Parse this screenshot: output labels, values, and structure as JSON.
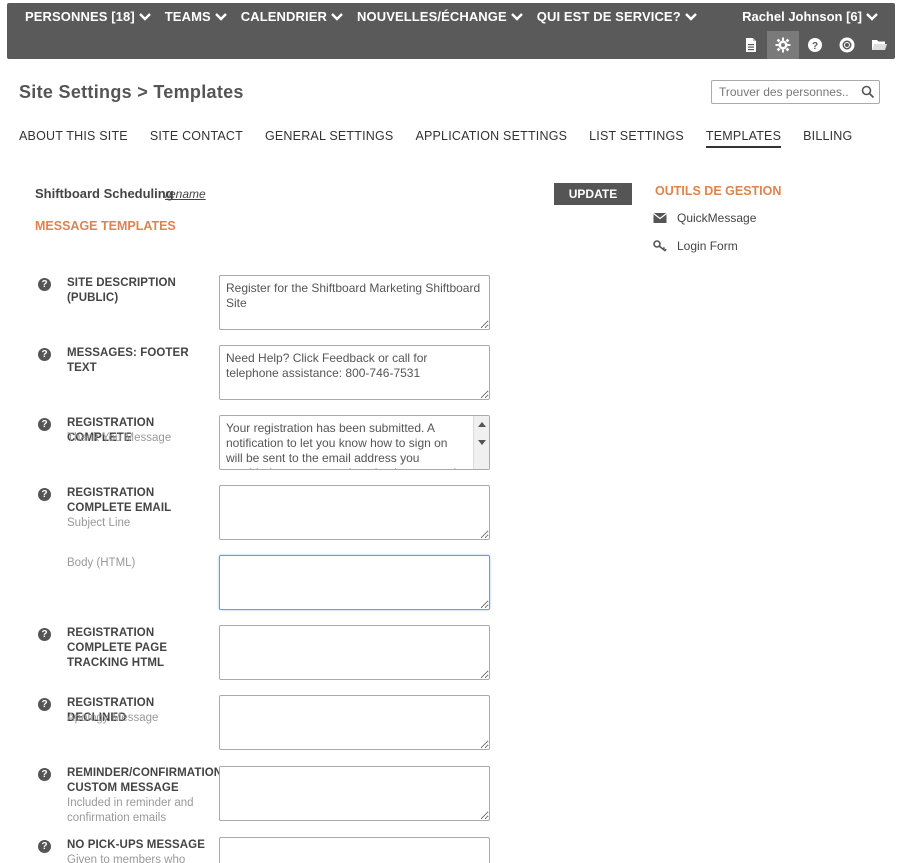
{
  "nav": {
    "items": [
      {
        "label": "PERSONNES [18]"
      },
      {
        "label": "TEAMS"
      },
      {
        "label": "CALENDRIER"
      },
      {
        "label": "NOUVELLES/ÉCHANGE"
      },
      {
        "label": "QUI EST DE SERVICE?"
      }
    ],
    "user": "Rachel Johnson [6]",
    "icons": [
      "document-icon",
      "gear-icon",
      "help-icon",
      "lifebuoy-icon",
      "folder-icon"
    ]
  },
  "page": {
    "title": "Site Settings > Templates",
    "search_placeholder": "Trouver des personnes.."
  },
  "tabs": [
    {
      "label": "ABOUT THIS SITE"
    },
    {
      "label": "SITE CONTACT"
    },
    {
      "label": "GENERAL SETTINGS"
    },
    {
      "label": "APPLICATION SETTINGS"
    },
    {
      "label": "LIST SETTINGS"
    },
    {
      "label": "TEMPLATES",
      "active": true
    },
    {
      "label": "BILLING"
    }
  ],
  "section": {
    "schedule_name": "Shiftboard Scheduling",
    "rename_label": "rename",
    "update_label": "UPDATE",
    "heading": "MESSAGE TEMPLATES"
  },
  "tools": {
    "title": "OUTILS DE GESTION",
    "links": [
      {
        "label": "QuickMessage",
        "icon": "envelope-icon"
      },
      {
        "label": "Login Form",
        "icon": "key-icon"
      }
    ]
  },
  "fields": {
    "site_description": {
      "label": "SITE DESCRIPTION (PUBLIC)",
      "value": "Register for the Shiftboard Marketing Shiftboard Site"
    },
    "footer_text": {
      "label": "MESSAGES: FOOTER TEXT",
      "value": "Need Help? Click Feedback or call for telephone assistance: 800-746-7531"
    },
    "registration_complete": {
      "label": "REGISTRATION COMPLETE",
      "sub": "Thank You Message",
      "value": "Your registration has been submitted. A notification to let you know how to sign on will be sent to the email address you provided once your registration is approved."
    },
    "registration_email": {
      "label": "REGISTRATION COMPLETE EMAIL",
      "sub": "Subject Line",
      "value": ""
    },
    "registration_email_body": {
      "sub": "Body (HTML)",
      "value": ""
    },
    "page_tracking": {
      "label": "REGISTRATION COMPLETE PAGE TRACKING HTML",
      "value": ""
    },
    "registration_declined": {
      "label": "REGISTRATION DECLINED",
      "sub": "Apology Message",
      "value": ""
    },
    "reminder": {
      "label": "REMINDER/CONFIRMATION CUSTOM MESSAGE",
      "sub": "Included in reminder and confirmation emails",
      "value": ""
    },
    "no_pickups": {
      "label": "NO PICK-UPS MESSAGE",
      "sub": "Given to members who",
      "value": ""
    }
  },
  "help_symbol": "?"
}
